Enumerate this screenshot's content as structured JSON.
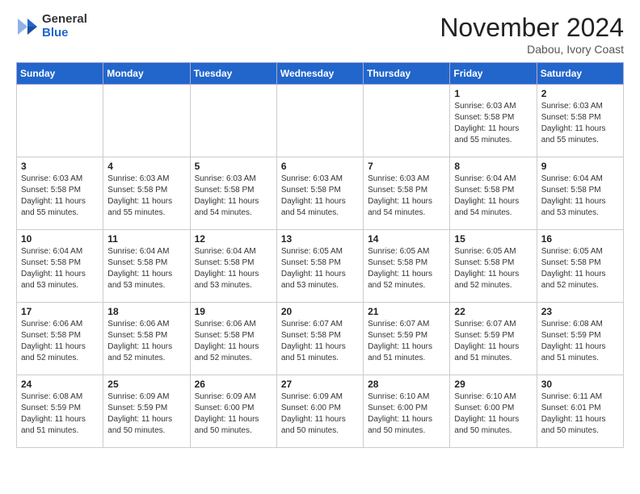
{
  "header": {
    "logo_general": "General",
    "logo_blue": "Blue",
    "month_title": "November 2024",
    "location": "Dabou, Ivory Coast"
  },
  "weekdays": [
    "Sunday",
    "Monday",
    "Tuesday",
    "Wednesday",
    "Thursday",
    "Friday",
    "Saturday"
  ],
  "weeks": [
    [
      {
        "day": "",
        "info": ""
      },
      {
        "day": "",
        "info": ""
      },
      {
        "day": "",
        "info": ""
      },
      {
        "day": "",
        "info": ""
      },
      {
        "day": "",
        "info": ""
      },
      {
        "day": "1",
        "info": "Sunrise: 6:03 AM\nSunset: 5:58 PM\nDaylight: 11 hours\nand 55 minutes."
      },
      {
        "day": "2",
        "info": "Sunrise: 6:03 AM\nSunset: 5:58 PM\nDaylight: 11 hours\nand 55 minutes."
      }
    ],
    [
      {
        "day": "3",
        "info": "Sunrise: 6:03 AM\nSunset: 5:58 PM\nDaylight: 11 hours\nand 55 minutes."
      },
      {
        "day": "4",
        "info": "Sunrise: 6:03 AM\nSunset: 5:58 PM\nDaylight: 11 hours\nand 55 minutes."
      },
      {
        "day": "5",
        "info": "Sunrise: 6:03 AM\nSunset: 5:58 PM\nDaylight: 11 hours\nand 54 minutes."
      },
      {
        "day": "6",
        "info": "Sunrise: 6:03 AM\nSunset: 5:58 PM\nDaylight: 11 hours\nand 54 minutes."
      },
      {
        "day": "7",
        "info": "Sunrise: 6:03 AM\nSunset: 5:58 PM\nDaylight: 11 hours\nand 54 minutes."
      },
      {
        "day": "8",
        "info": "Sunrise: 6:04 AM\nSunset: 5:58 PM\nDaylight: 11 hours\nand 54 minutes."
      },
      {
        "day": "9",
        "info": "Sunrise: 6:04 AM\nSunset: 5:58 PM\nDaylight: 11 hours\nand 53 minutes."
      }
    ],
    [
      {
        "day": "10",
        "info": "Sunrise: 6:04 AM\nSunset: 5:58 PM\nDaylight: 11 hours\nand 53 minutes."
      },
      {
        "day": "11",
        "info": "Sunrise: 6:04 AM\nSunset: 5:58 PM\nDaylight: 11 hours\nand 53 minutes."
      },
      {
        "day": "12",
        "info": "Sunrise: 6:04 AM\nSunset: 5:58 PM\nDaylight: 11 hours\nand 53 minutes."
      },
      {
        "day": "13",
        "info": "Sunrise: 6:05 AM\nSunset: 5:58 PM\nDaylight: 11 hours\nand 53 minutes."
      },
      {
        "day": "14",
        "info": "Sunrise: 6:05 AM\nSunset: 5:58 PM\nDaylight: 11 hours\nand 52 minutes."
      },
      {
        "day": "15",
        "info": "Sunrise: 6:05 AM\nSunset: 5:58 PM\nDaylight: 11 hours\nand 52 minutes."
      },
      {
        "day": "16",
        "info": "Sunrise: 6:05 AM\nSunset: 5:58 PM\nDaylight: 11 hours\nand 52 minutes."
      }
    ],
    [
      {
        "day": "17",
        "info": "Sunrise: 6:06 AM\nSunset: 5:58 PM\nDaylight: 11 hours\nand 52 minutes."
      },
      {
        "day": "18",
        "info": "Sunrise: 6:06 AM\nSunset: 5:58 PM\nDaylight: 11 hours\nand 52 minutes."
      },
      {
        "day": "19",
        "info": "Sunrise: 6:06 AM\nSunset: 5:58 PM\nDaylight: 11 hours\nand 52 minutes."
      },
      {
        "day": "20",
        "info": "Sunrise: 6:07 AM\nSunset: 5:58 PM\nDaylight: 11 hours\nand 51 minutes."
      },
      {
        "day": "21",
        "info": "Sunrise: 6:07 AM\nSunset: 5:59 PM\nDaylight: 11 hours\nand 51 minutes."
      },
      {
        "day": "22",
        "info": "Sunrise: 6:07 AM\nSunset: 5:59 PM\nDaylight: 11 hours\nand 51 minutes."
      },
      {
        "day": "23",
        "info": "Sunrise: 6:08 AM\nSunset: 5:59 PM\nDaylight: 11 hours\nand 51 minutes."
      }
    ],
    [
      {
        "day": "24",
        "info": "Sunrise: 6:08 AM\nSunset: 5:59 PM\nDaylight: 11 hours\nand 51 minutes."
      },
      {
        "day": "25",
        "info": "Sunrise: 6:09 AM\nSunset: 5:59 PM\nDaylight: 11 hours\nand 50 minutes."
      },
      {
        "day": "26",
        "info": "Sunrise: 6:09 AM\nSunset: 6:00 PM\nDaylight: 11 hours\nand 50 minutes."
      },
      {
        "day": "27",
        "info": "Sunrise: 6:09 AM\nSunset: 6:00 PM\nDaylight: 11 hours\nand 50 minutes."
      },
      {
        "day": "28",
        "info": "Sunrise: 6:10 AM\nSunset: 6:00 PM\nDaylight: 11 hours\nand 50 minutes."
      },
      {
        "day": "29",
        "info": "Sunrise: 6:10 AM\nSunset: 6:00 PM\nDaylight: 11 hours\nand 50 minutes."
      },
      {
        "day": "30",
        "info": "Sunrise: 6:11 AM\nSunset: 6:01 PM\nDaylight: 11 hours\nand 50 minutes."
      }
    ]
  ]
}
